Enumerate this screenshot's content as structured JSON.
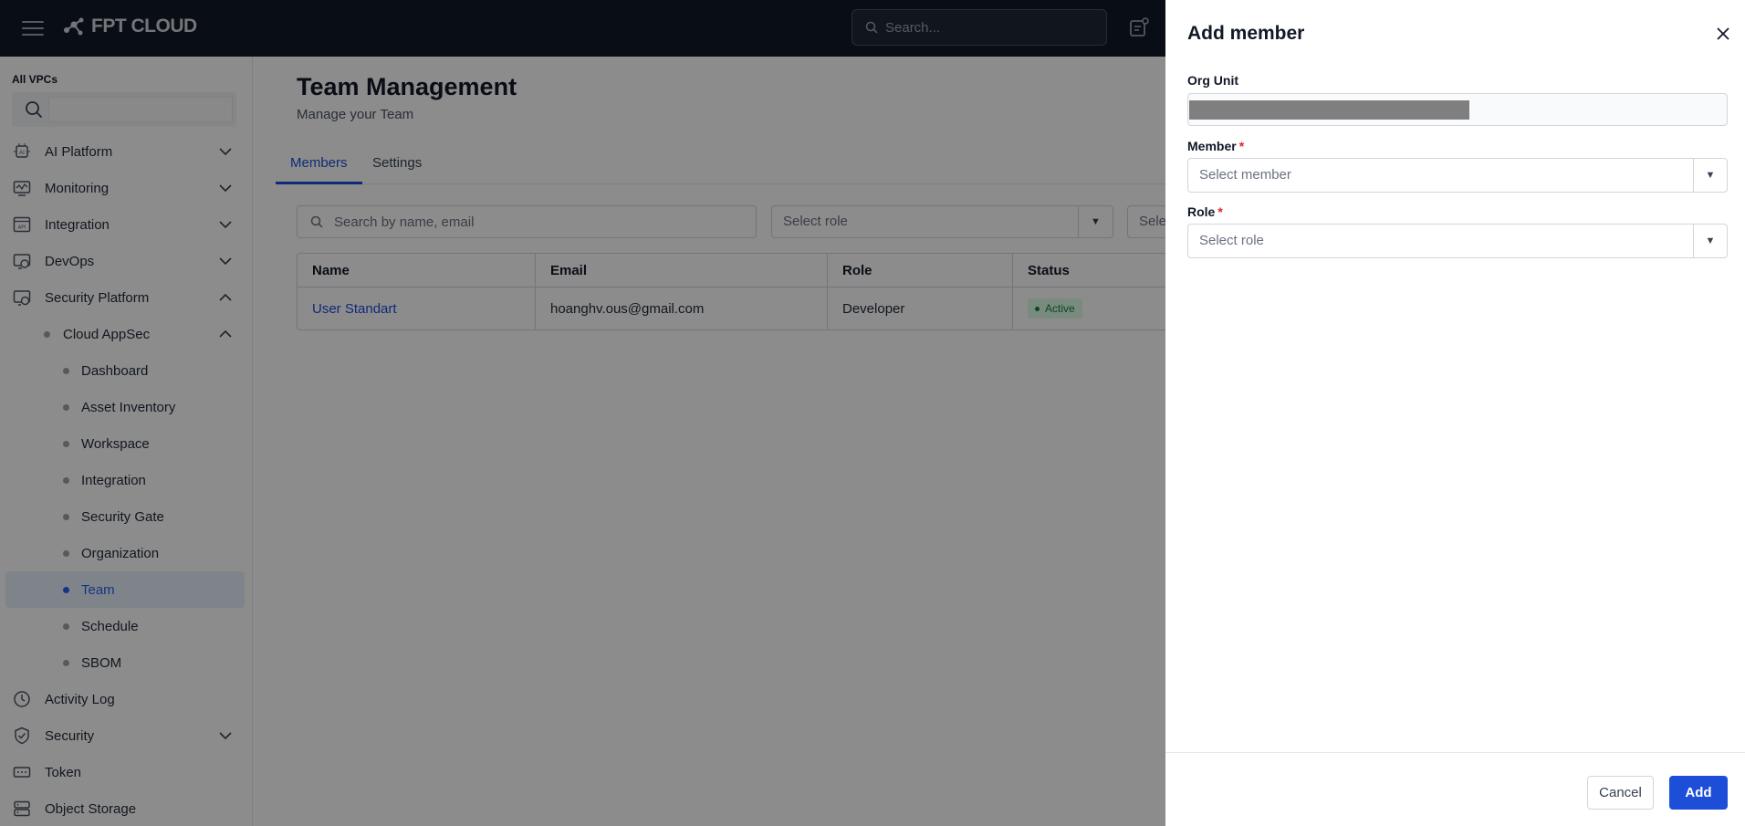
{
  "topbar": {
    "brand": "FPT CLOUD",
    "search_placeholder": "Search..."
  },
  "sidebar": {
    "vpc_label": "All VPCs",
    "items": [
      {
        "label": "AI Platform",
        "icon": "ai-chip-icon",
        "expanded": false
      },
      {
        "label": "Monitoring",
        "icon": "monitoring-icon",
        "expanded": false
      },
      {
        "label": "Integration",
        "icon": "api-icon",
        "expanded": false
      },
      {
        "label": "DevOps",
        "icon": "devops-icon",
        "expanded": false
      },
      {
        "label": "Security Platform",
        "icon": "security-platform-icon",
        "expanded": true
      },
      {
        "label": "Activity Log",
        "icon": "clock-icon"
      },
      {
        "label": "Security",
        "icon": "shield-icon",
        "expanded": false
      },
      {
        "label": "Token",
        "icon": "token-icon"
      },
      {
        "label": "Object Storage",
        "icon": "storage-icon"
      }
    ],
    "cloud_appsec": "Cloud AppSec",
    "sub_items": [
      "Dashboard",
      "Asset Inventory",
      "Workspace",
      "Integration",
      "Security Gate",
      "Organization",
      "Team",
      "Schedule",
      "SBOM"
    ],
    "active_item": "Team"
  },
  "main": {
    "title": "Team Management",
    "subtitle": "Manage your Team",
    "tabs": [
      "Members",
      "Settings"
    ],
    "active_tab": "Members",
    "search_placeholder": "Search by name, email",
    "role_filter_placeholder": "Select role",
    "status_filter_placeholder": "Sele",
    "table": {
      "columns": [
        "Name",
        "Email",
        "Role",
        "Status"
      ],
      "rows": [
        {
          "name": "User Standart",
          "email": "hoanghv.ous@gmail.com",
          "role": "Developer",
          "status": "Active"
        }
      ]
    }
  },
  "drawer": {
    "title": "Add member",
    "org_unit_label": "Org Unit",
    "member_label": "Member",
    "member_placeholder": "Select member",
    "role_label": "Role",
    "role_placeholder": "Select role",
    "required_mark": "*",
    "cancel_label": "Cancel",
    "add_label": "Add"
  },
  "colors": {
    "accent": "#1d4ed8",
    "topbar": "#111827",
    "status_active_bg": "#dcfce7",
    "status_active_text": "#15803d",
    "required": "#dc2626"
  }
}
